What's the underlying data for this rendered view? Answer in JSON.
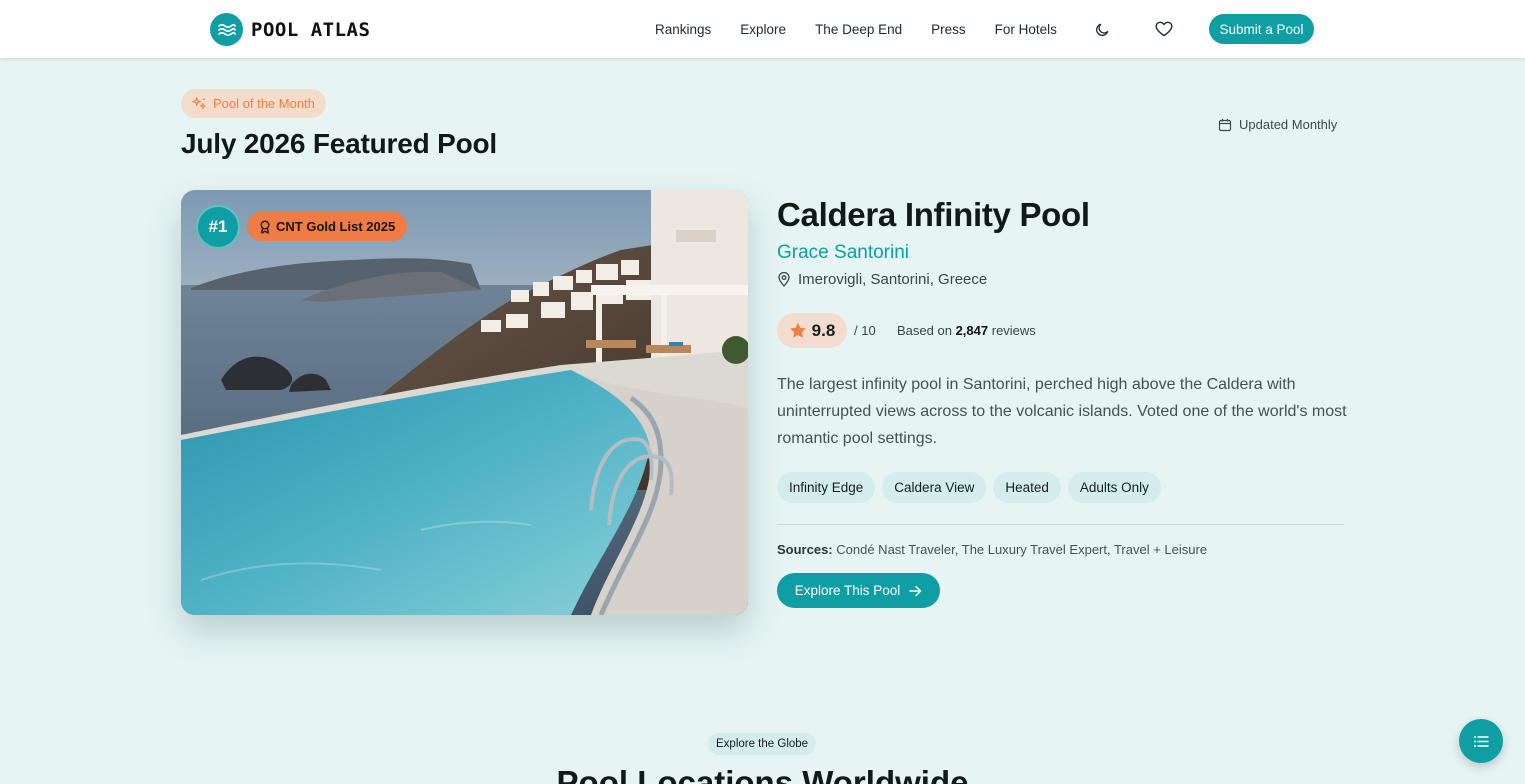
{
  "header": {
    "logo_text": "POOL ATLAS",
    "nav": [
      "Rankings",
      "Explore",
      "The Deep End",
      "Press",
      "For Hotels"
    ],
    "theme_icon": "moon-icon",
    "favorites_icon": "heart-icon",
    "submit_label": "Submit a Pool"
  },
  "featured": {
    "pill_label": "Pool of the Month",
    "pill_icon": "sparkles-icon",
    "title": "July 2026 Featured Pool",
    "updated_label": "Updated Monthly",
    "updated_icon": "calendar-icon",
    "rank_badge": "#1",
    "award_label": "CNT Gold List 2025",
    "award_icon": "award-ribbon-icon",
    "pool_name": "Caldera Infinity Pool",
    "hotel_name": "Grace Santorini",
    "location": "Imerovigli, Santorini, Greece",
    "location_icon": "map-pin-icon",
    "rating": "9.8",
    "rating_out_of": "/ 10",
    "reviews_prefix": "Based on",
    "reviews_count": "2,847",
    "reviews_suffix": "reviews",
    "description": "The largest infinity pool in Santorini, perched high above the Caldera with uninterrupted views across to the volcanic islands. Voted one of the world's most romantic pool settings.",
    "tags": [
      "Infinity Edge",
      "Caldera View",
      "Heated",
      "Adults Only"
    ],
    "sources_label": "Sources:",
    "sources_text": "Condé Nast Traveler, The Luxury Travel Expert, Travel + Leisure",
    "cta_label": "Explore This Pool"
  },
  "next_section": {
    "pill_label": "Explore the Globe",
    "title": "Pool Locations Worldwide"
  },
  "colors": {
    "accent": "#0e9ea3",
    "orange": "#ef7b45",
    "background": "#e7f4f4"
  }
}
